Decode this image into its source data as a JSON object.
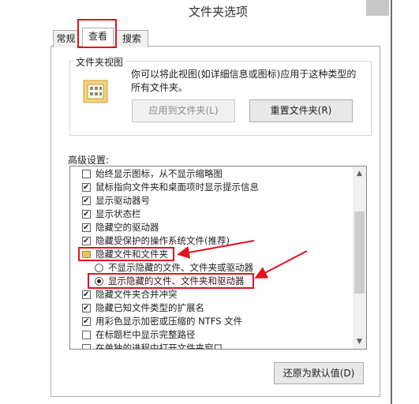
{
  "window": {
    "title": "文件夹选项"
  },
  "tabs": [
    {
      "label": "常规"
    },
    {
      "label": "查看"
    },
    {
      "label": "搜索"
    }
  ],
  "folder_view": {
    "group_label": "文件夹视图",
    "description": "你可以将此视图(如详细信息或图标)应用于这种类型的所有文件夹。",
    "apply_button": "应用到文件夹(L)",
    "reset_button": "重置文件夹(R)"
  },
  "advanced": {
    "label": "高级设置:",
    "items": [
      {
        "type": "checkbox",
        "checked": false,
        "label": "始终显示图标，从不显示缩略图"
      },
      {
        "type": "checkbox",
        "checked": true,
        "label": "鼠标指向文件夹和桌面项时显示提示信息"
      },
      {
        "type": "checkbox",
        "checked": true,
        "label": "显示驱动器号"
      },
      {
        "type": "checkbox",
        "checked": true,
        "label": "显示状态栏"
      },
      {
        "type": "checkbox",
        "checked": true,
        "label": "隐藏空的驱动器"
      },
      {
        "type": "checkbox",
        "checked": true,
        "label": "隐藏受保护的操作系统文件(推荐)"
      },
      {
        "type": "folder",
        "label": "隐藏文件和文件夹"
      },
      {
        "type": "radio",
        "checked": false,
        "label": "不显示隐藏的文件、文件夹或驱动器"
      },
      {
        "type": "radio",
        "checked": true,
        "label": "显示隐藏的文件、文件夹和驱动器"
      },
      {
        "type": "checkbox",
        "checked": true,
        "label": "隐藏文件夹合并冲突"
      },
      {
        "type": "checkbox",
        "checked": true,
        "label": "隐藏已知文件类型的扩展名"
      },
      {
        "type": "checkbox",
        "checked": true,
        "label": "用彩色显示加密或压缩的 NTFS 文件"
      },
      {
        "type": "checkbox",
        "checked": false,
        "label": "在标题栏中显示完整路径"
      },
      {
        "type": "checkbox",
        "checked": false,
        "label": "在单独的进程中打开文件夹窗口"
      }
    ]
  },
  "restore_button": "还原为默认值(D)",
  "colors": {
    "annotation": "#e0141e",
    "folder": "#e8c15a"
  }
}
